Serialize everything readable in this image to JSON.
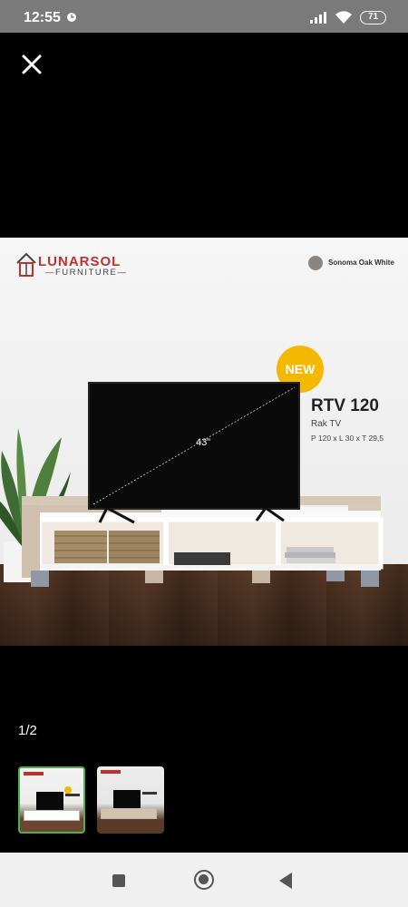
{
  "status_bar": {
    "time": "12:55",
    "battery": "71",
    "icons": [
      "alarm-icon",
      "signal-icon",
      "wifi-icon",
      "battery-icon"
    ]
  },
  "viewer": {
    "close_icon": "close-icon",
    "page_indicator": "1/2"
  },
  "product": {
    "brand": "LUNARSOL",
    "brand_sub": "FURNITURE",
    "color_variant": "Sonoma Oak White",
    "badge": "NEW",
    "model": "RTV 120",
    "type": "Rak TV",
    "dimensions": "P 120 x L 30 x T 29,5",
    "tv_size": "43\""
  },
  "thumbnails": [
    {
      "selected": true
    },
    {
      "selected": false
    }
  ],
  "nav_bar": {
    "icons": [
      "recents-square-icon",
      "home-circle-icon",
      "back-triangle-icon"
    ]
  },
  "colors": {
    "brand_red": "#c2302c",
    "badge_yellow": "#f5b800",
    "thumbnail_selected": "#4caf50",
    "status_bar": "#7a7a7a"
  }
}
